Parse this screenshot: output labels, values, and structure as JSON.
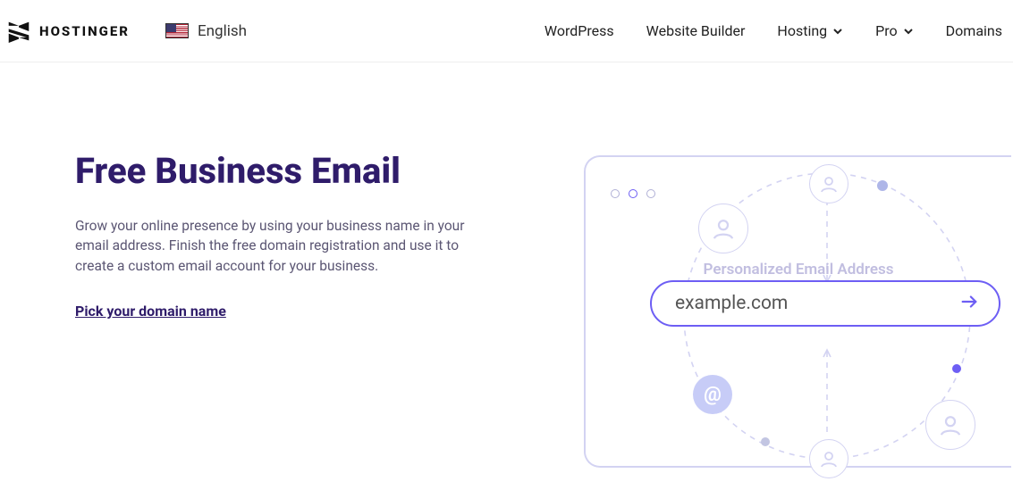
{
  "brand": {
    "name": "HOSTINGER"
  },
  "language": {
    "label": "English"
  },
  "nav": {
    "wordpress": "WordPress",
    "builder": "Website Builder",
    "hosting": "Hosting",
    "pro": "Pro",
    "domains": "Domains"
  },
  "hero": {
    "title": "Free Business Email",
    "description": "Grow your online presence by using your business name in your email address. Finish the free domain registration and use it to create a custom email account for your business.",
    "cta": "Pick your domain name"
  },
  "illustration": {
    "label": "Personalized Email Address",
    "search_value": "example.com"
  }
}
